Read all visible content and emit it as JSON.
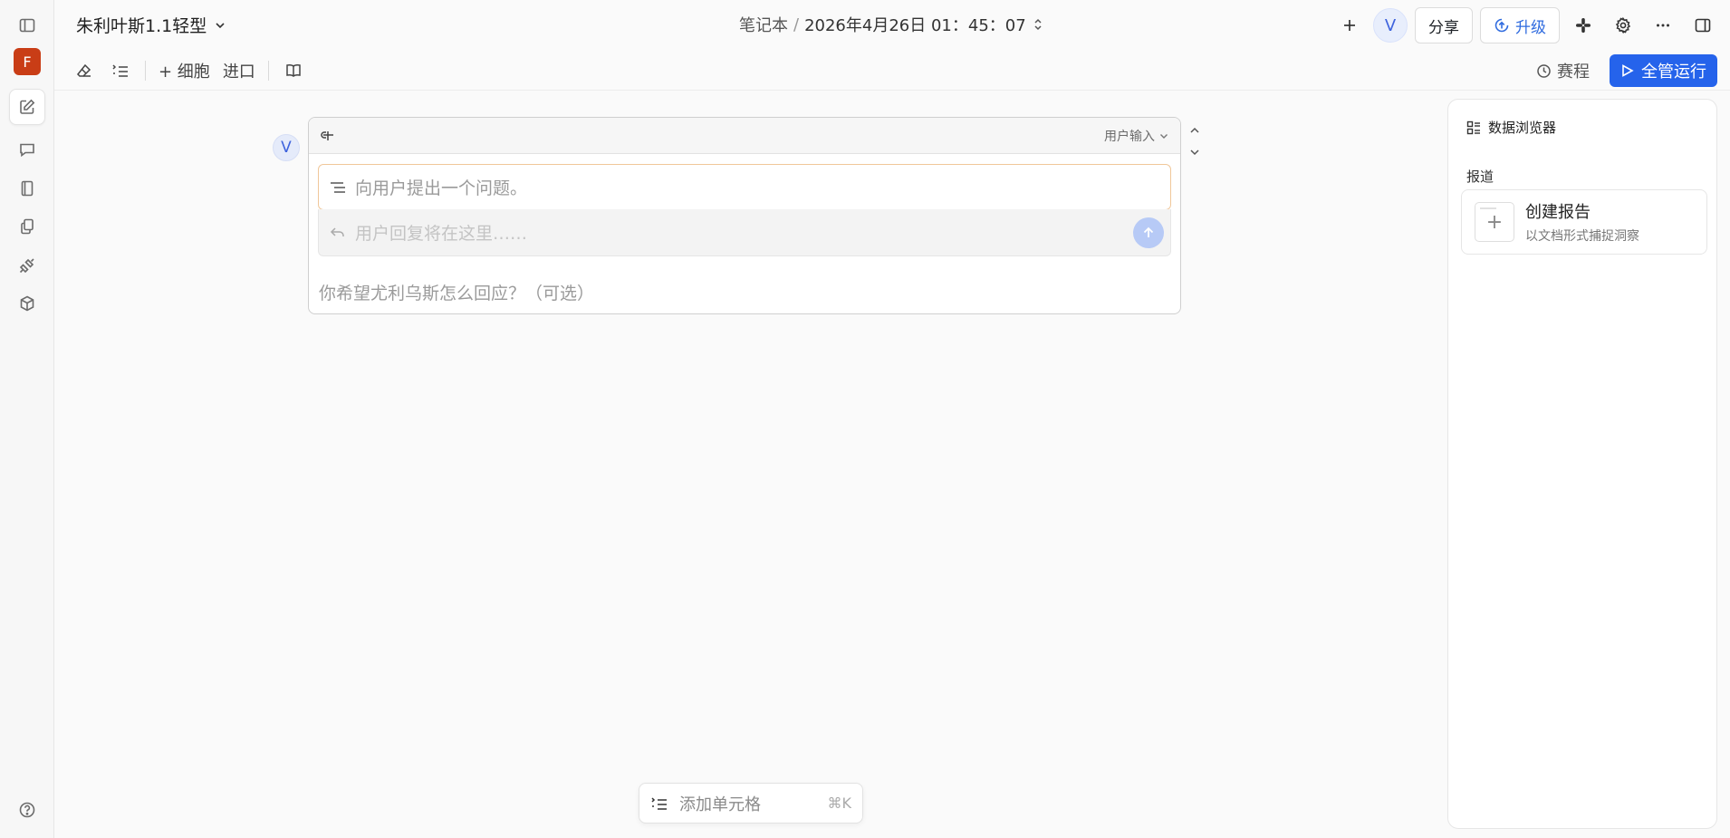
{
  "app": {
    "workspace_initial": "F",
    "notebook_title": "朱利叶斯1.1轻型"
  },
  "breadcrumb": {
    "root": "笔记本",
    "separator": "/",
    "current": "2026年4月26日 01：45：07"
  },
  "header": {
    "user_initial": "V",
    "share_label": "分享",
    "upgrade_label": "升级"
  },
  "toolbar": {
    "add_cell_label": "+ 细胞",
    "import_label": "进口",
    "schedule_label": "赛程",
    "run_all_label": "全管运行"
  },
  "cell": {
    "avatar_initial": "V",
    "type_label": "用户输入",
    "question_placeholder": "向用户提出一个问题。",
    "reply_placeholder": "用户回复将在这里……",
    "response_placeholder": "你希望尤利乌斯怎么回应？（可选）"
  },
  "add_cell_bar": {
    "label": "添加单元格",
    "shortcut": "⌘K"
  },
  "data_browser": {
    "title": "数据浏览器",
    "section": "报道",
    "card_title": "创建报告",
    "card_subtitle": "以文档形式捕捉洞察"
  },
  "colors": {
    "accent": "#2563eb",
    "workspace": "#c93d16",
    "question_border": "#f0c79a"
  }
}
